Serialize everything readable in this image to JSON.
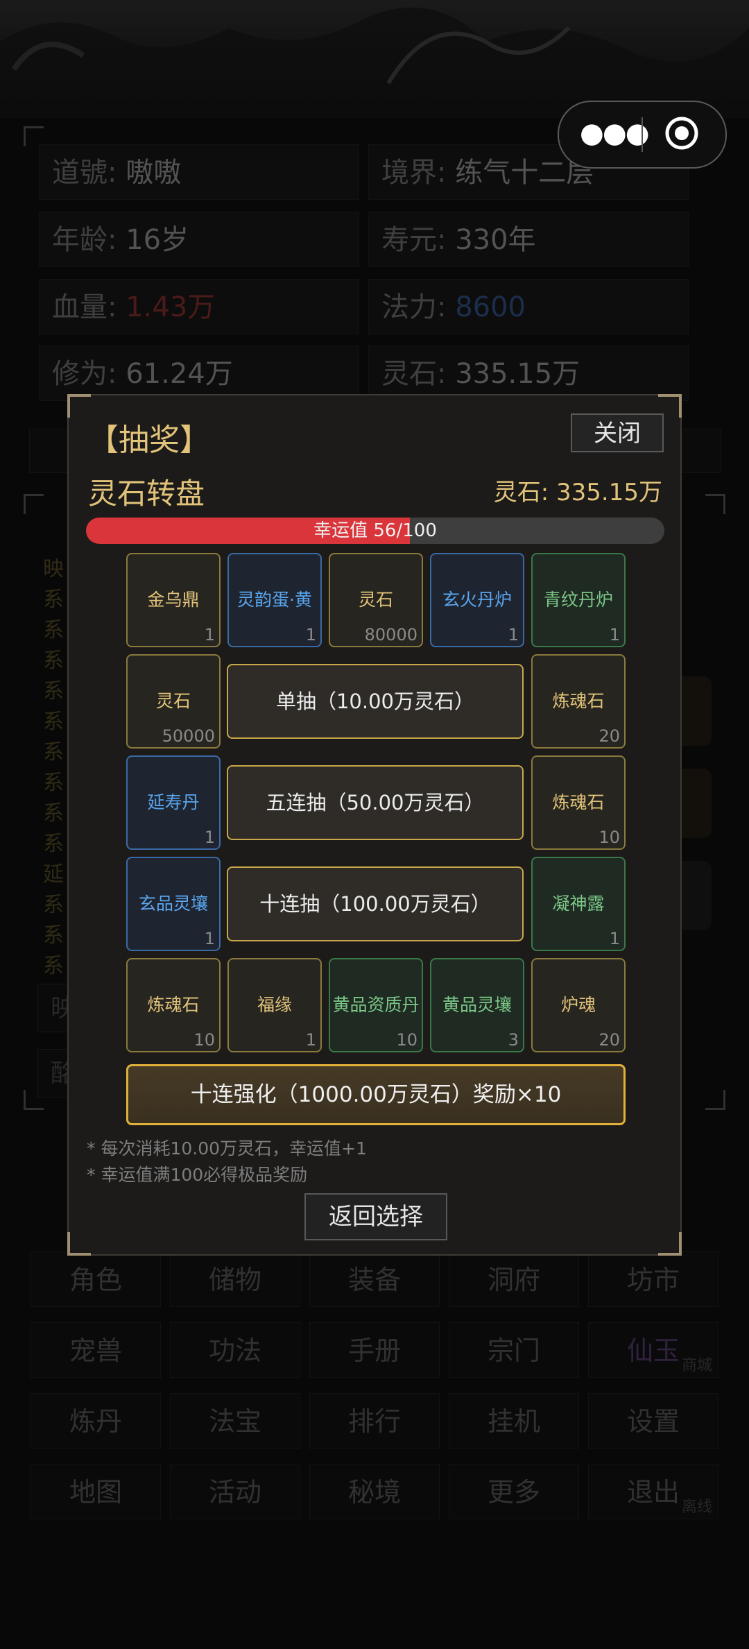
{
  "background": {
    "stats": [
      {
        "label": "道號:",
        "value": "嗷嗷",
        "tone": "normal"
      },
      {
        "label": "境界:",
        "value": "练气十二层",
        "tone": "normal"
      },
      {
        "label": "年龄:",
        "value": "16岁",
        "tone": "normal"
      },
      {
        "label": "寿元:",
        "value": "330年",
        "tone": "normal"
      },
      {
        "label": "血量:",
        "value": "1.43万",
        "tone": "red"
      },
      {
        "label": "法力:",
        "value": "8600",
        "tone": "blue"
      },
      {
        "label": "修为:",
        "value": "61.24万",
        "tone": "normal"
      },
      {
        "label": "灵石:",
        "value": "335.15万",
        "tone": "normal"
      }
    ],
    "log_lines": [
      "映",
      "系",
      "系",
      "系",
      "系",
      "系",
      "系",
      "系",
      "系",
      "系",
      "延",
      "系",
      "系",
      "系"
    ],
    "inputs": [
      "映",
      "酩"
    ],
    "menu": [
      {
        "label": "角色"
      },
      {
        "label": "储物"
      },
      {
        "label": "装备"
      },
      {
        "label": "洞府"
      },
      {
        "label": "坊市"
      },
      {
        "label": "宠兽"
      },
      {
        "label": "功法"
      },
      {
        "label": "手册"
      },
      {
        "label": "宗门"
      },
      {
        "label": "仙玉",
        "sub": "商城"
      },
      {
        "label": "炼丹"
      },
      {
        "label": "法宝"
      },
      {
        "label": "排行"
      },
      {
        "label": "挂机"
      },
      {
        "label": "设置"
      },
      {
        "label": "地图"
      },
      {
        "label": "活动"
      },
      {
        "label": "秘境"
      },
      {
        "label": "更多"
      },
      {
        "label": "退出",
        "sub": "离线"
      }
    ]
  },
  "capsule": {
    "more_icon": "more-dots-icon",
    "target_icon": "target-icon"
  },
  "modal": {
    "title": "【抽奖】",
    "close_label": "关闭",
    "wheel_title": "灵石转盘",
    "balance": "灵石: 335.15万",
    "luck": {
      "text": "幸运值 56/100",
      "value": 56,
      "max": 100,
      "fill_color": "#d9353b"
    },
    "prizes": [
      {
        "name": "金乌鼎",
        "qty": "1",
        "rarity": "gold"
      },
      {
        "name": "灵韵蛋·黄",
        "qty": "1",
        "rarity": "blue"
      },
      {
        "name": "灵石",
        "qty": "80000",
        "rarity": "gold"
      },
      {
        "name": "玄火丹炉",
        "qty": "1",
        "rarity": "blue"
      },
      {
        "name": "青纹丹炉",
        "qty": "1",
        "rarity": "green"
      },
      {
        "name": "灵石",
        "qty": "50000",
        "rarity": "gold"
      },
      {
        "name": "炼魂石",
        "qty": "20",
        "rarity": "gold"
      },
      {
        "name": "延寿丹",
        "qty": "1",
        "rarity": "blue"
      },
      {
        "name": "炼魂石",
        "qty": "10",
        "rarity": "gold"
      },
      {
        "name": "玄品灵壤",
        "qty": "1",
        "rarity": "blue"
      },
      {
        "name": "凝神露",
        "qty": "1",
        "rarity": "green"
      },
      {
        "name": "炼魂石",
        "qty": "10",
        "rarity": "gold"
      },
      {
        "name": "福缘",
        "qty": "1",
        "rarity": "gold"
      },
      {
        "name": "黄品资质丹",
        "qty": "10",
        "rarity": "green"
      },
      {
        "name": "黄品灵壤",
        "qty": "3",
        "rarity": "green"
      },
      {
        "name": "炉魂",
        "qty": "20",
        "rarity": "gold"
      }
    ],
    "draw_buttons": [
      "单抽（10.00万灵石）",
      "五连抽（50.00万灵石）",
      "十连抽（100.00万灵石）"
    ],
    "super_button": "十连强化（1000.00万灵石）奖励×10",
    "notes": [
      "* 每次消耗10.00万灵石，幸运值+1",
      "* 幸运值满100必得极品奖励"
    ],
    "back_label": "返回选择"
  }
}
